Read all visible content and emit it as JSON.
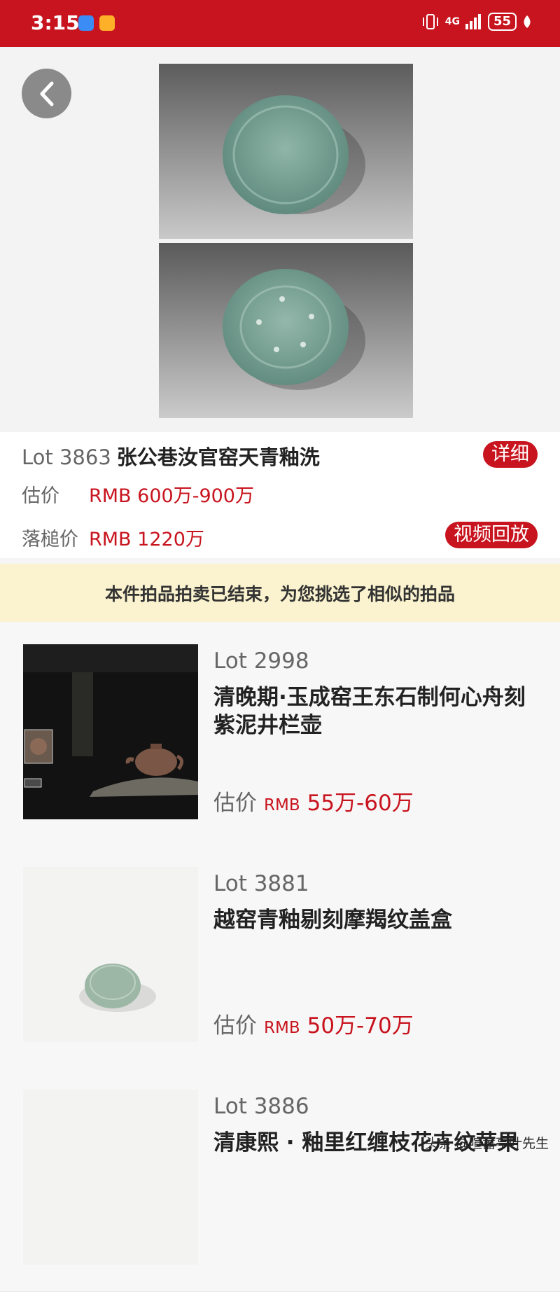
{
  "status_bar": {
    "time": "3:15",
    "network": "4G",
    "battery": "55"
  },
  "hero": {
    "images": [
      "ceramic-brush-washer-top-view",
      "ceramic-brush-washer-bottom-view"
    ]
  },
  "lot": {
    "lot_number": "Lot 3863",
    "title": "张公巷汝官窑天青釉洗",
    "detail_button": "详细",
    "estimate_label": "估价",
    "estimate_value": "RMB 600万-900万",
    "hammer_label": "落槌价",
    "hammer_value": "RMB 1220万",
    "video_button": "视频回放"
  },
  "notice": {
    "text": "本件拍品拍卖已结束，为您挑选了相似的拍品"
  },
  "similar_items": [
    {
      "lot": "Lot 2998",
      "title": "清晚期·玉成窑王东石制何心舟刻紫泥井栏壶",
      "estimate_label": "估价",
      "currency": "RMB",
      "estimate": "55万-60万"
    },
    {
      "lot": "Lot 3881",
      "title": "越窑青釉剔刻摩羯纹盖盒",
      "estimate_label": "估价",
      "currency": "RMB",
      "estimate": "50万-70万"
    },
    {
      "lot": "Lot 3886",
      "title": "清康熙 · 釉里红缠枝花卉纹苹果",
      "estimate_label": "",
      "currency": "",
      "estimate": ""
    }
  ],
  "watermark": "头条 @喧嚣亭叶先生",
  "colors": {
    "accent": "#c8141e",
    "notice_bg": "#fbf3cf"
  }
}
